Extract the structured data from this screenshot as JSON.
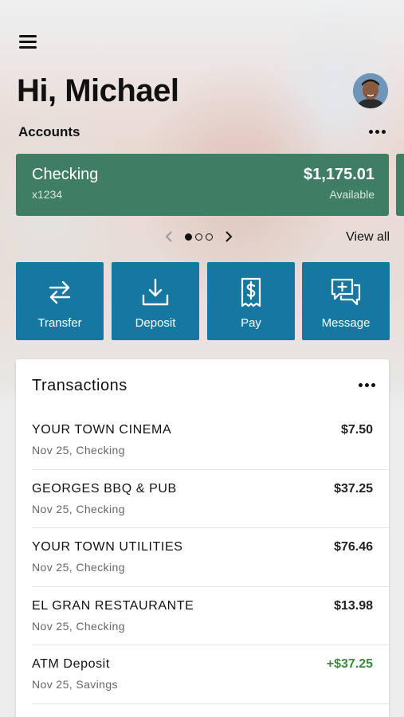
{
  "header": {
    "greeting": "Hi, Michael"
  },
  "accounts": {
    "label": "Accounts",
    "card": {
      "name": "Checking",
      "number": "x1234",
      "balance": "$1,175.01",
      "balance_label": "Available"
    },
    "pager": {
      "current_page": 1,
      "total_pages": 3
    },
    "view_all_label": "View all"
  },
  "actions": [
    {
      "label": "Transfer",
      "icon": "transfer-arrows-icon"
    },
    {
      "label": "Deposit",
      "icon": "deposit-download-icon"
    },
    {
      "label": "Pay",
      "icon": "bill-dollar-icon"
    },
    {
      "label": "Message",
      "icon": "message-plus-icon"
    }
  ],
  "transactions": {
    "title": "Transactions",
    "items": [
      {
        "name": "YOUR TOWN CINEMA",
        "meta": "Nov 25, Checking",
        "amount": "$7.50",
        "type": "debit"
      },
      {
        "name": "GEORGES BBQ & PUB",
        "meta": "Nov 25, Checking",
        "amount": "$37.25",
        "type": "debit"
      },
      {
        "name": "YOUR TOWN UTILITIES",
        "meta": "Nov 25, Checking",
        "amount": "$76.46",
        "type": "debit"
      },
      {
        "name": "EL GRAN RESTAURANTE",
        "meta": "Nov 25, Checking",
        "amount": "$13.98",
        "type": "debit"
      },
      {
        "name": "ATM Deposit",
        "meta": "Nov 25, Savings",
        "amount": "+$37.25",
        "type": "credit"
      }
    ]
  },
  "colors": {
    "account_card": "#3f7d65",
    "action_button": "#1677a0",
    "credit_amount": "#3a8a3a"
  }
}
